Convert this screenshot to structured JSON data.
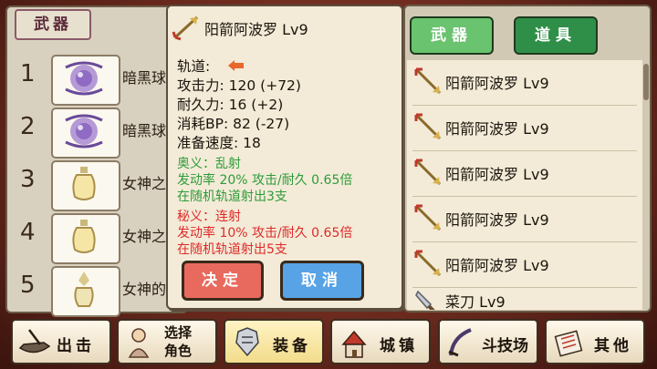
{
  "left_panel": {
    "tab_label": "武器",
    "slots": [
      {
        "number": "1",
        "name": "暗黑球",
        "icon": "dark-orb-icon"
      },
      {
        "number": "2",
        "name": "暗黑球",
        "icon": "dark-orb-icon"
      },
      {
        "number": "3",
        "name": "女神之",
        "icon": "potion-bottle-icon"
      },
      {
        "number": "4",
        "name": "女神之",
        "icon": "potion-bottle-icon"
      },
      {
        "number": "5",
        "name": "女神的",
        "icon": "crystal-vial-icon"
      }
    ]
  },
  "detail": {
    "title": "阳箭阿波罗 Lv9",
    "trajectory_label": "轨道:",
    "attack": "攻击力: 120 (+72)",
    "durability": "耐久力: 16 (+2)",
    "bp_cost": "消耗BP: 82 (-27)",
    "prep_speed": "准备速度: 18",
    "secret1_title": "奥义：乱射",
    "secret1_line1": "发动率 20%  攻击/耐久 0.65倍",
    "secret1_line2": "在随机轨道射出3支",
    "secret2_title": "秘义：连射",
    "secret2_line1": "发动率 10%    攻击/耐久 0.65倍",
    "secret2_line2": "在随机轨道射出5支",
    "confirm_label": "决定",
    "cancel_label": "取消"
  },
  "right_panel": {
    "tab_weapon_label": "武器",
    "tab_item_label": "道具",
    "items": [
      {
        "name": "阳箭阿波罗 Lv9",
        "icon": "arrow-icon"
      },
      {
        "name": "阳箭阿波罗 Lv9",
        "icon": "arrow-icon"
      },
      {
        "name": "阳箭阿波罗 Lv9",
        "icon": "arrow-icon"
      },
      {
        "name": "阳箭阿波罗 Lv9",
        "icon": "arrow-icon"
      },
      {
        "name": "阳箭阿波罗 Lv9",
        "icon": "arrow-icon"
      },
      {
        "name": "菜刀 Lv9",
        "icon": "kitchen-knife-icon"
      }
    ]
  },
  "nav": {
    "sortie": "出击",
    "select_line1": "选择",
    "select_line2": "角色",
    "equip": "装备",
    "town": "城镇",
    "arena": "斗技场",
    "other": "其他"
  },
  "colors": {
    "accent_green": "#6ac36e",
    "accent_dark_green": "#2f8f48",
    "confirm_red": "#e86a5e",
    "cancel_blue": "#57a3e6",
    "effect_green": "#2e9b3a",
    "effect_red": "#de2a2a"
  }
}
